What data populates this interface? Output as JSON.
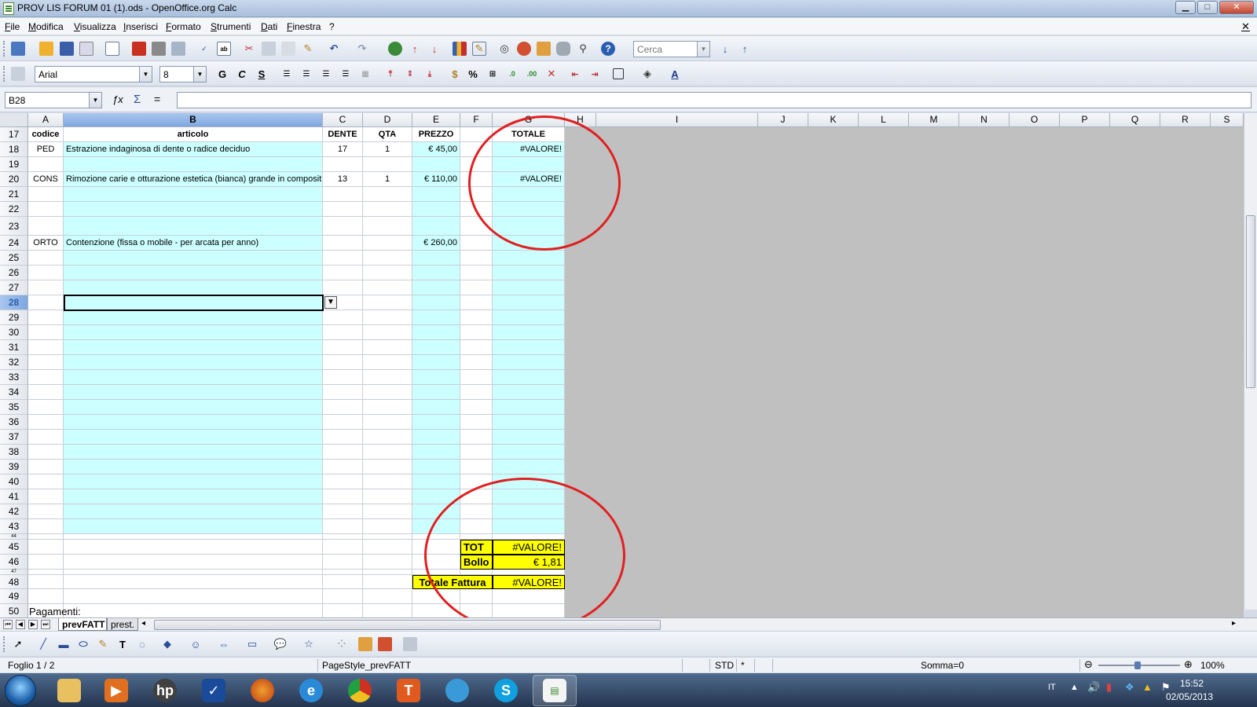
{
  "window": {
    "title": "PROV LIS FORUM 01 (1).ods - OpenOffice.org Calc",
    "min_glyph": "▁",
    "max_glyph": "□",
    "close_glyph": "✕"
  },
  "menu": [
    "File",
    "Modifica",
    "Visualizza",
    "Inserisci",
    "Formato",
    "Strumenti",
    "Dati",
    "Finestra",
    "?"
  ],
  "doc_close_glyph": "✕",
  "toolbar": {
    "search_placeholder": "Cerca",
    "font_name": "Arial",
    "font_size": "8",
    "bold_glyph": "G",
    "italic_glyph": "C",
    "underline_glyph": "S",
    "percent_glyph": "%"
  },
  "formula_bar": {
    "cell_ref": "B28",
    "formula": "",
    "sum_glyph": "Σ",
    "equals_glyph": "="
  },
  "columns": [
    "A",
    "B",
    "C",
    "D",
    "E",
    "F",
    "G",
    "H",
    "I",
    "J",
    "K",
    "L",
    "M",
    "N",
    "O",
    "P",
    "Q",
    "R",
    "S"
  ],
  "header_row": {
    "row": "17",
    "A": "codice",
    "B": "articolo",
    "C": "DENTE",
    "D": "QTA",
    "E": "PREZZO",
    "G": "TOTALE"
  },
  "rows": [
    {
      "n": "18",
      "A": "PED",
      "B": "Estrazione indaginosa di dente o radice deciduo",
      "C": "17",
      "D": "1",
      "E": "€ 45,00",
      "G": "#VALORE!"
    },
    {
      "n": "19"
    },
    {
      "n": "20",
      "A": "CONS",
      "B": "Rimozione carie e otturazione estetica (bianca) grande in composit",
      "C": "13",
      "D": "1",
      "E": "€ 110,00",
      "G": "#VALORE!"
    },
    {
      "n": "21"
    },
    {
      "n": "22"
    },
    {
      "n": "23"
    },
    {
      "n": "24",
      "A": "ORTO",
      "B": "Contenzione (fissa o mobile - per arcata per anno)",
      "E": "€ 260,00"
    },
    {
      "n": "25"
    },
    {
      "n": "26"
    },
    {
      "n": "27"
    },
    {
      "n": "28"
    },
    {
      "n": "29"
    },
    {
      "n": "30"
    },
    {
      "n": "31"
    },
    {
      "n": "32"
    },
    {
      "n": "33"
    },
    {
      "n": "34"
    },
    {
      "n": "35"
    },
    {
      "n": "36"
    },
    {
      "n": "37"
    },
    {
      "n": "38"
    },
    {
      "n": "39"
    },
    {
      "n": "40"
    },
    {
      "n": "41"
    },
    {
      "n": "42"
    },
    {
      "n": "43"
    }
  ],
  "lower_rows": [
    "44",
    "45",
    "46",
    "47",
    "48",
    "49",
    "50"
  ],
  "totals": {
    "tot_label": "TOT",
    "tot_value": "#VALORE!",
    "bollo_label": "Bollo",
    "bollo_value": "€ 1,81",
    "fattura_label": "Totale Fattura",
    "fattura_value": "#VALORE!"
  },
  "pagamenti_label": "Pagamenti:",
  "sheets": [
    "prevFATT",
    "prest."
  ],
  "status": {
    "sheet": "Foglio 1 / 2",
    "page_style": "PageStyle_prevFATT",
    "mode": "STD",
    "modified": "*",
    "sum": "Somma=0",
    "zoom": "100%"
  },
  "taskbar": {
    "lang": "IT",
    "time": "15:52",
    "date": "02/05/2013"
  },
  "colors": {
    "cyan_cells": "#ccffff",
    "yellow_totals": "#ffff00",
    "annotation_circle": "#e02020"
  }
}
